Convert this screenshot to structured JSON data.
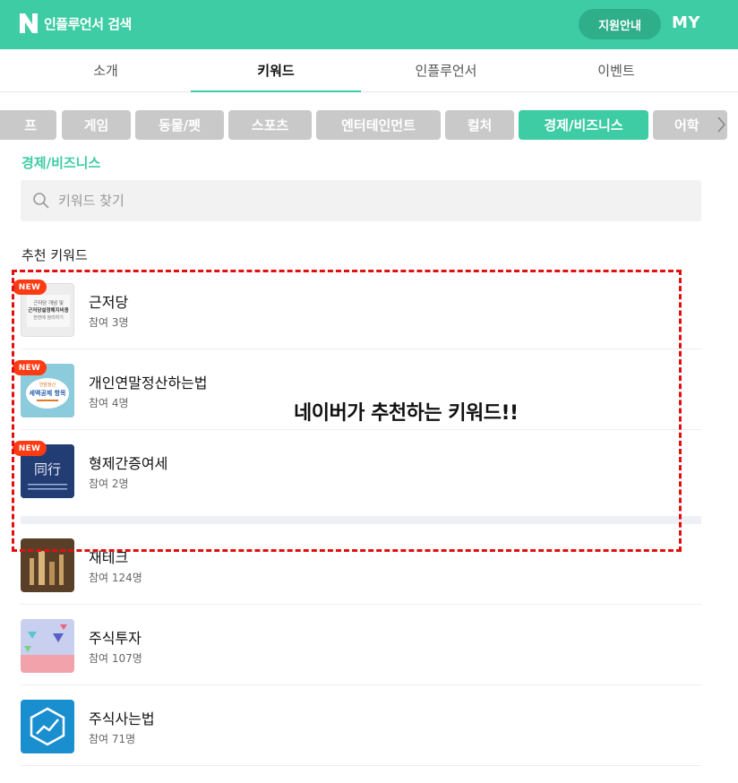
{
  "header": {
    "title": "인플루언서 검색",
    "support_label": "지원안내",
    "my_label": "MY",
    "logo_letter": "N"
  },
  "tabs": [
    {
      "label": "소개"
    },
    {
      "label": "키워드"
    },
    {
      "label": "인플루언서"
    },
    {
      "label": "이벤트"
    }
  ],
  "categories": [
    "프",
    "게임",
    "동물/펫",
    "스포츠",
    "엔터테인먼트",
    "컬처",
    "경제/비즈니스",
    "어학"
  ],
  "current_category": "경제/비즈니스",
  "search": {
    "placeholder": "키워드 찾기"
  },
  "recommended": {
    "title": "추천 키워드",
    "annotation": "네이버가 추천하는 키워드!!",
    "new_label": "NEW",
    "items": [
      {
        "name": "근저당",
        "count": "참여 3명"
      },
      {
        "name": "개인연말정산하는법",
        "count": "참여 4명"
      },
      {
        "name": "형제간증여세",
        "count": "참여 2명"
      }
    ]
  },
  "keywords": [
    {
      "name": "재테크",
      "count": "참여 124명"
    },
    {
      "name": "주식투자",
      "count": "참여 107명"
    },
    {
      "name": "주식사는법",
      "count": "참여 71명"
    }
  ],
  "thumb_text": {
    "t1_line1": "근저당 개념 및",
    "t1_line2": "근저당설정해지비용",
    "t1_line3": "한번에 정리하기",
    "t2_line1": "연말정산",
    "t2_line2": "세액공제 항목",
    "t3_glyph": "同行"
  },
  "colors": {
    "brand": "#3dcca3",
    "new_badge": "#ff3b13",
    "annotation_border": "#e01010"
  }
}
